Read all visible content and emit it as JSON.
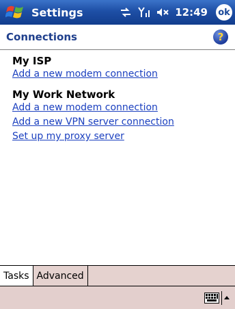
{
  "titlebar": {
    "app_title": "Settings",
    "clock": "12:49",
    "ok_label": "ok"
  },
  "header": {
    "title": "Connections",
    "help_glyph": "?"
  },
  "groups": [
    {
      "title": "My ISP",
      "links": [
        "Add a new modem connection"
      ]
    },
    {
      "title": "My Work Network",
      "links": [
        "Add a new modem connection",
        "Add a new VPN server connection",
        "Set up my proxy server"
      ]
    }
  ],
  "tabs": [
    {
      "label": "Tasks",
      "active": true
    },
    {
      "label": "Advanced",
      "active": false
    }
  ],
  "icons": {
    "start": "windows-flag-icon",
    "connectivity": "connectivity-icon",
    "signal": "signal-icon",
    "volume": "volume-muted-icon",
    "help": "help-icon",
    "keyboard": "keyboard-icon"
  },
  "colors": {
    "titlebar": "#1e4fa6",
    "page_title": "#1f3f8c",
    "link": "#1a3fbf",
    "menubar": "#e3cfcd"
  }
}
